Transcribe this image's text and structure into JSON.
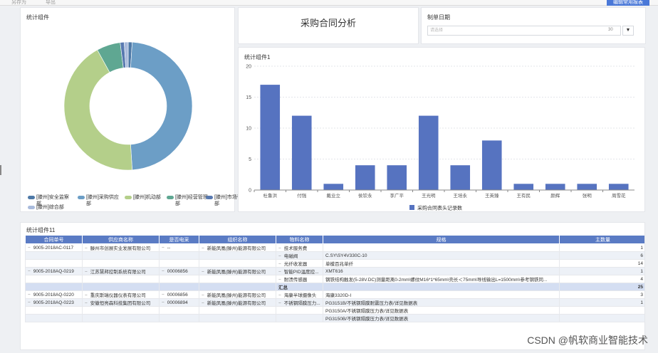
{
  "topbar": {
    "items": [
      "另存为",
      "导出"
    ],
    "button": "编辑常用报表"
  },
  "donut_panel": {
    "title": "统计组件",
    "legend": [
      {
        "label": "[滕州]安全监察部",
        "color": "#4e79a7"
      },
      {
        "label": "[滕州]采购供应部",
        "color": "#6c9ec6"
      },
      {
        "label": "[滕州]机动部",
        "color": "#b4cf8a"
      },
      {
        "label": "[滕州]经营管理部",
        "color": "#5fa792"
      },
      {
        "label": "[滕州]市场营销部",
        "color": "#5879b0"
      },
      {
        "label": "[滕州]综合部",
        "color": "#a9bbdc"
      }
    ]
  },
  "title_panel": {
    "title": "采购合同分析"
  },
  "date_panel": {
    "label": "制单日期",
    "placeholder": "请选择",
    "value_hint": "30",
    "dropdown_icon": "▼"
  },
  "bar_panel": {
    "title": "统计组件1"
  },
  "chart_data": [
    {
      "type": "pie",
      "title": "统计组件",
      "categories": [
        "[滕州]安全监察部",
        "[滕州]采购供应部",
        "[滕州]机动部",
        "[滕州]经营管理部",
        "[滕州]市场营销部",
        "[滕州]综合部"
      ],
      "values": [
        1,
        48,
        43,
        6,
        1,
        1
      ],
      "donut": true
    },
    {
      "type": "bar",
      "title": "统计组件1",
      "categories": [
        "杜鲁洪",
        "付强",
        "戴业立",
        "侯钦永",
        "李广平",
        "王光明",
        "王培永",
        "王英臻",
        "王有民",
        "颜辉",
        "张明",
        "周雪花"
      ],
      "values": [
        17,
        12,
        1,
        4,
        4,
        12,
        4,
        8,
        1,
        1,
        1,
        1
      ],
      "series": [
        {
          "name": "采购合同表头记录数",
          "values": [
            17,
            12,
            1,
            4,
            4,
            12,
            4,
            8,
            1,
            1,
            1,
            1
          ]
        }
      ],
      "ylim": [
        0,
        20
      ],
      "yticks": [
        "0",
        "5",
        "10",
        "15",
        "20"
      ],
      "grid": true,
      "legend_position": "bottom",
      "color": "#5673c0"
    }
  ],
  "table_panel": {
    "title": "统计组件11",
    "headers": [
      "合同单号",
      "供应商名称",
      "是否电采",
      "组织名称",
      "物料名称",
      "规格",
      "主数量"
    ],
    "rows": [
      {
        "c1": "9005-2018AC-0117",
        "c2": "滕州市创展实业发展有限公司",
        "c3": "--",
        "c4": "新能凤凰(滕州)能源有限公司",
        "c5": "技术服务费",
        "c6": "",
        "c7": "1"
      },
      {
        "c1": "",
        "c2": "",
        "c3": "",
        "c4": "",
        "c5": "电磁阀",
        "c6": "C.SY\\SY4V330C-10",
        "c7": "6"
      },
      {
        "c1": "",
        "c2": "",
        "c3": "",
        "c4": "",
        "c5": "光纤收发器",
        "c6": "单模百兆单纤",
        "c7": "14"
      },
      {
        "c1": "9005-2018AQ-0219",
        "c2": "江苏慧邦控制系统有限公司",
        "c3": "00006856",
        "c4": "新能凤凰(滕州)能源有限公司",
        "c5": "智能PID温度控...",
        "c6": "XMT616",
        "c7": "1"
      },
      {
        "c1": "",
        "c2": "",
        "c3": "",
        "c4": "",
        "c5": "耐溃传感器",
        "c6": "钢铁结构触发(5-28V.DC)测量距离0-2mm\\螺纹M16*1*65mm\\壳长＜75mm\\导线输出L=1500mm\\参考钢铁同...",
        "c7": "4"
      },
      {
        "c1": "",
        "c2": "",
        "c3": "",
        "c4": "",
        "c5": "汇总",
        "c6": "",
        "c7": "25",
        "sum": true
      },
      {
        "c1": "9005-2018AQ-0220",
        "c2": "重庆斯瑞仪器仪表有限公司",
        "c3": "00006856",
        "c4": "新能凤凰(滕州)能源有限公司",
        "c5": "海康半球摄像头",
        "c6": "海康3320D-I",
        "c7": "3"
      },
      {
        "c1": "9005-2018AQ-0223",
        "c2": "安徽恒亮森科技集团有限公司",
        "c3": "00006894",
        "c4": "新能凤凰(滕州)能源有限公司",
        "c5": "不锈钢隔膜压力...",
        "c6": "PG3151B/不锈钢隔膜耐震压力表/详见数据表",
        "c7": "1"
      },
      {
        "c1": "",
        "c2": "",
        "c3": "",
        "c4": "",
        "c5": "",
        "c6": "PG3150A/不锈钢隔膜压力表/详见数据表",
        "c7": ""
      },
      {
        "c1": "",
        "c2": "",
        "c3": "",
        "c4": "",
        "c5": "",
        "c6": "PG3150B/不锈钢隔膜压力表/详见数据表",
        "c7": ""
      }
    ]
  },
  "watermark": "CSDN @帆软商业智能技术"
}
